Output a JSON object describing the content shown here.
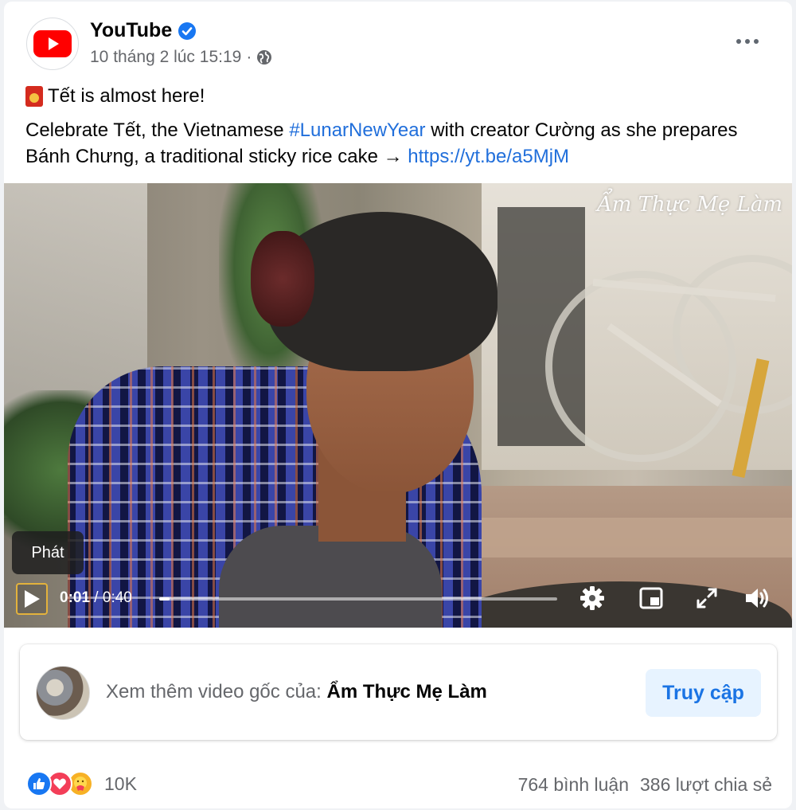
{
  "header": {
    "page_name": "YouTube",
    "timestamp": "10 tháng 2 lúc 15:19",
    "separator": "·",
    "verified_icon": "verified-badge-icon",
    "privacy_icon": "globe-icon",
    "more_icon": "more-options-icon"
  },
  "post": {
    "line1": "Tết is almost here!",
    "line1_icon": "red-envelope-icon",
    "body_prefix": "Celebrate Tết, the Vietnamese ",
    "hashtag": "#LunarNewYear",
    "body_middle": " with creator Cường as she prepares Bánh Chưng, a traditional sticky rice cake → ",
    "link": "https://yt.be/a5MjM"
  },
  "video": {
    "watermark": "Ẩm Thực Mẹ Làm",
    "tooltip": "Phát",
    "current_time": "0:01",
    "time_separator": " / ",
    "duration": "0:40",
    "progress_fraction": 0.025,
    "icons": [
      "play-icon",
      "settings-gear-icon",
      "picture-in-picture-icon",
      "fullscreen-icon",
      "volume-icon"
    ]
  },
  "source_card": {
    "prefix": "Xem thêm video gốc của: ",
    "channel_name": "Ẩm Thực Mẹ Làm",
    "button_label": "Truy cập"
  },
  "footer": {
    "reactions": [
      "like-icon",
      "love-icon",
      "care-icon"
    ],
    "reaction_count": "10K",
    "comments": "764 bình luận",
    "shares": "386 lượt chia sẻ"
  },
  "colors": {
    "link": "#216fdb",
    "brand_red": "#ff0000",
    "visit_button_bg": "#e7f3ff",
    "visit_button_text": "#1b74e4"
  }
}
